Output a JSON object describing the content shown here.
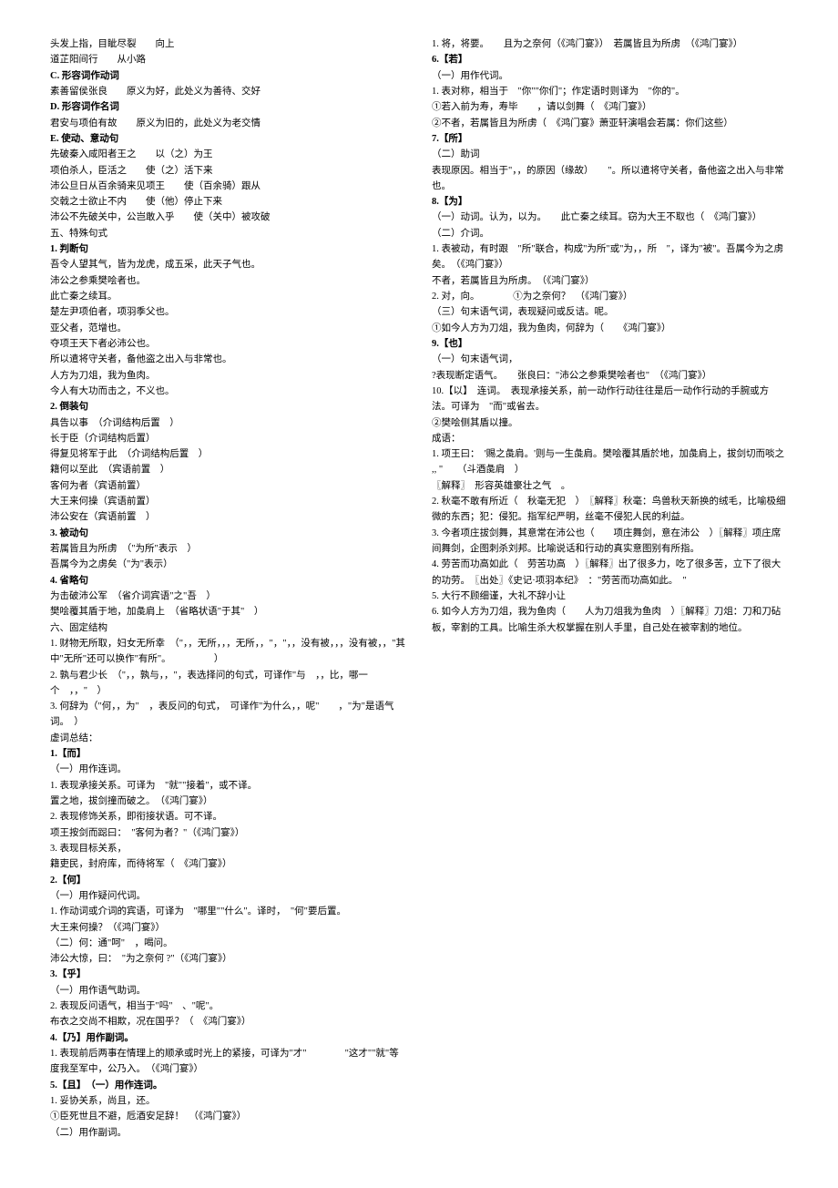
{
  "left": [
    {
      "t": "头发上指，目眦尽裂　　向上"
    },
    {
      "t": "道芷阳间行　　从小路"
    },
    {
      "t": "C. 形容词作动词",
      "b": true
    },
    {
      "t": "素善留侯张良　　原义为好，此处义为善待、交好"
    },
    {
      "t": "D. 形容词作名词",
      "b": true
    },
    {
      "t": "君安与项伯有故　　原义为旧的，此处义为老交情"
    },
    {
      "t": "E. 使动、意动句",
      "b": true
    },
    {
      "t": "先破秦入咸阳者王之　　以（之）为王"
    },
    {
      "t": "项伯杀人，臣活之　　使（之）活下来"
    },
    {
      "t": "沛公旦日从百余骑来见项王　　使（百余骑）跟从"
    },
    {
      "t": "交戟之士欲止不内　　使（他）停止下来"
    },
    {
      "t": "沛公不先破关中，公岂敢入乎　　使（关中）被攻破"
    },
    {
      "t": "五、特殊句式"
    },
    {
      "t": "1. 判断句",
      "b": true
    },
    {
      "t": "吾令人望其气，皆为龙虎，成五采，此天子气也。"
    },
    {
      "t": "沛公之参乘樊哙者也。"
    },
    {
      "t": "此亡秦之续耳。"
    },
    {
      "t": "楚左尹项伯者，项羽季父也。"
    },
    {
      "t": "亚父者，范增也。"
    },
    {
      "t": "夺项王天下者必沛公也。"
    },
    {
      "t": "所以遣将守关者，备他盗之出入与非常也。"
    },
    {
      "t": "人方为刀俎，我为鱼肉。"
    },
    {
      "t": "今人有大功而击之，不义也。"
    },
    {
      "t": "2. 倒装句",
      "b": true
    },
    {
      "t": "具告以事　（介词结构后置　）"
    },
    {
      "t": "长于臣（介词结构后置）"
    },
    {
      "t": "得复见将军于此　（介词结构后置　）"
    },
    {
      "t": "籍何以至此　（宾语前置　）"
    },
    {
      "t": "客何为者（宾语前置）"
    },
    {
      "t": "大王来何操（宾语前置）"
    },
    {
      "t": "沛公安在（宾语前置　）"
    },
    {
      "t": "3. 被动句",
      "b": true
    },
    {
      "t": "若属皆且为所虏　（\"为所\"表示　）"
    },
    {
      "t": "吾属今为之虏矣（\"为\"表示）"
    },
    {
      "t": "4. 省略句",
      "b": true
    },
    {
      "t": "为击破沛公军　（省介词宾语\"之\"吾　）"
    },
    {
      "t": "樊哙覆其盾于地，加彘肩上　（省略状语\"于其\"　）"
    },
    {
      "t": "六、固定结构"
    },
    {
      "t": "1. 财物无所取，妇女无所幸　（\"，，无所，，，无所，，\"，\"，，没有被，，，没有被，，\"其中\"无所\"还可以换作\"有所\"。　　　　　）"
    },
    {
      "t": "2. 孰与君少长　（\"，，孰与，，\"，表选择问的句式，可译作\"与　，，比，哪一个　，，\"　）"
    },
    {
      "t": "3. 何辞为（\"何，，为\"　，表反问的句式，　可译作\"为什么，，呢\"　　，\"为\"是语气词。　）"
    },
    {
      "t": "虚词总结："
    },
    {
      "t": "1.【而】",
      "b": true
    },
    {
      "t": "（一）用作连词。"
    },
    {
      "t": "1. 表现承接关系。可译为　\"就\"\"接着\"，或不译。"
    },
    {
      "t": "置之地，拔剑撞而破之。　（《鸿门宴》）"
    },
    {
      "t": "2. 表现修饰关系，即衔接状语。可不译。"
    },
    {
      "t": "项王按剑而跽曰：　\"客何为者？\"（《鸿门宴》）"
    },
    {
      "t": "3. 表现目标关系，"
    },
    {
      "t": "籍吏民，封府库，而待将军（　《鸿门宴》）"
    },
    {
      "t": "2.【何】",
      "b": true
    },
    {
      "t": "（一）用作疑问代词。"
    },
    {
      "t": "1. 作动词或介词的宾语，可译为　\"哪里\"\"什么\"。译时，　\"何\"要后置。"
    },
    {
      "t": "大王来何操？（《鸿门宴》）"
    },
    {
      "t": "（二）何：通\"呵\"　，喝问。"
    },
    {
      "t": "沛公大惊，曰：　\"为之奈何 ?\"（《鸿门宴》）"
    },
    {
      "t": "3.【乎】",
      "b": true
    },
    {
      "t": "（一）用作语气助词。"
    },
    {
      "t": "2. 表现反问语气，相当于\"吗\"　、\"呢\"。"
    },
    {
      "t": "布衣之交尚不相欺，况在国乎？（　《鸿门宴》）"
    },
    {
      "t": "4.【乃】用作副词。",
      "b": true
    },
    {
      "t": "1. 表现前后两事在情理上的顺承或时光上的紧接，可译为\"才\"　　　　\"这才\"\"就\"等"
    },
    {
      "t": "度我至军中，公乃入。　（《鸿门宴》）"
    },
    {
      "t": "5.【且】　（一）用作连词。",
      "b": true
    },
    {
      "t": "1. 妥协关系，尚且，还。"
    },
    {
      "t": "①臣死世且不避，卮酒安足辞！　（《鸿门宴》）"
    },
    {
      "t": "（二）用作副词。"
    }
  ],
  "right": [
    {
      "t": "1. 将，将要。　　且为之奈何（《鸿门宴》）　若属皆且为所虏　（《鸿门宴》）"
    },
    {
      "t": "6.【若】",
      "b": true
    },
    {
      "t": "（一）用作代词。"
    },
    {
      "t": "1. 表对称，相当于　\"你\"\"你们\"；作定语时则译为　\"你的\"。"
    },
    {
      "t": "①若入前为寿，寿毕　　，请以剑舞（　《鸿门宴》）"
    },
    {
      "t": "②不者，若属皆且为所虏（　《鸿门宴》萧亚轩演唱会若属：你们这些）"
    },
    {
      "t": "7.【所】",
      "b": true
    },
    {
      "t": "（二）助词"
    },
    {
      "t": "表现原因。相当于\"，，的原因（缘故）　　\"。所以遣将守关者，备他盗之出入与非常也。"
    },
    {
      "t": "8.【为】",
      "b": true
    },
    {
      "t": "（一）动词。认为，以为。　　此亡秦之续耳。窃为大王不取也（　《鸿门宴》）"
    },
    {
      "t": "（二）介词。"
    },
    {
      "t": "1. 表被动，有时跟　\"所\"联合，构成\"为所\"或\"为，，所　\"，译为\"被\"。吾属今为之虏矣。　（《鸿门宴》）"
    },
    {
      "t": "不者，若属皆且为所虏。　（《鸿门宴》）"
    },
    {
      "t": "2. 对，向。　　　　①为之奈何？　（《鸿门宴》）"
    },
    {
      "t": "（三）句末语气词，表现疑问或反诘。呢。"
    },
    {
      "t": "①如今人方为刀俎，我为鱼肉，何辞为（　　《鸿门宴》）"
    },
    {
      "t": "9.【也】",
      "b": true
    },
    {
      "t": "（一）句末语气词，"
    },
    {
      "t": "?表现断定语气。　　张良曰：\"沛公之参乘樊哙者也\"　（《鸿门宴》）"
    },
    {
      "t": "10.【以】　连词。　表现承接关系，前一动作行动往往是后一动作行动的手腕或方法。可译为　\"而\"或省去。"
    },
    {
      "t": "②樊哙侧其盾以撞。"
    },
    {
      "t": "成语："
    },
    {
      "t": "1. 项王曰：　'赐之彘肩。'则与一生彘肩。樊哙覆其盾於地，加彘肩上，拔剑切而啖之 ,, \"　　（斗酒彘肩　）"
    },
    {
      "t": "〖解释〗　形容英雄豪壮之气　。"
    },
    {
      "t": "2. 秋毫不敢有所近（　秋毫无犯　）　〖解释〗秋毫：鸟兽秋天新换的绒毛，比喻极细微的东西；犯：侵犯。指军纪严明，丝毫不侵犯人民的利益。"
    },
    {
      "t": "3. 今者项庄拔剑舞，其意常在沛公也（　　项庄舞剑，意在沛公　）〖解释〗项庄席间舞剑，企图刺杀刘邦。比喻说话和行动的真实意图别有所指。"
    },
    {
      "t": "4. 劳苦而功高如此（　劳苦功高　）〖解释〗出了很多力，吃了很多苦，立下了很大的功劳。　〖出处〗《史记·项羽本纪》　：\"劳苦而功高如此。　\""
    },
    {
      "t": "5. 大行不顾细谨，大礼不辞小让"
    },
    {
      "t": "6. 如今人方为刀俎，我为鱼肉（　　人为刀俎我为鱼肉　）〖解释〗刀俎：刀和刀砧板，宰割的工具。比喻生杀大权掌握在别人手里，自己处在被宰割的地位。"
    }
  ]
}
